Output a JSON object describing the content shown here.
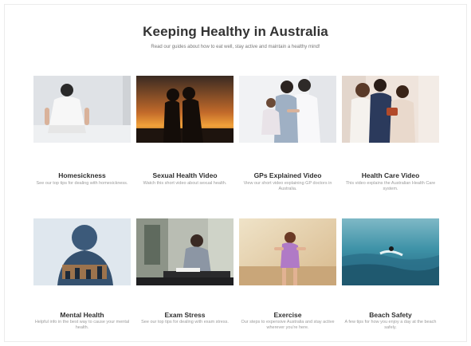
{
  "page": {
    "title": "Keeping Healthy in Australia",
    "subtitle": "Read our guides about how to eat well, stay active and maintain a healthy mind!"
  },
  "cards": [
    {
      "title": "Homesickness",
      "description": "See our top tips for dealing with homesickness.",
      "image_icon": "sitting-person-photo"
    },
    {
      "title": "Sexual Health Video",
      "description": "Watch this short video about sexual health.",
      "image_icon": "couple-sunset-photo"
    },
    {
      "title": "GPs Explained Video",
      "description": "View our short video explaining GP doctors in Australia.",
      "image_icon": "doctor-family-photo"
    },
    {
      "title": "Health Care Video",
      "description": "This video explains the Australian Health Care system.",
      "image_icon": "family-group-photo"
    },
    {
      "title": "Mental Health",
      "description": "Helpful info in the best way to cause your mental health.",
      "image_icon": "double-exposure-photo"
    },
    {
      "title": "Exam Stress",
      "description": "See our top tips for dealing with exam stress.",
      "image_icon": "student-desk-photo"
    },
    {
      "title": "Exercise",
      "description": "Our steps to expensive Australia and stay active wherever you're here.",
      "image_icon": "runner-photo"
    },
    {
      "title": "Beach Safety",
      "description": "A few tips for how you enjoy a day at the beach safely.",
      "image_icon": "ocean-surfer-photo"
    }
  ],
  "colors": {
    "background": "#ffffff",
    "title": "#333333",
    "description": "#9a9a9a"
  }
}
